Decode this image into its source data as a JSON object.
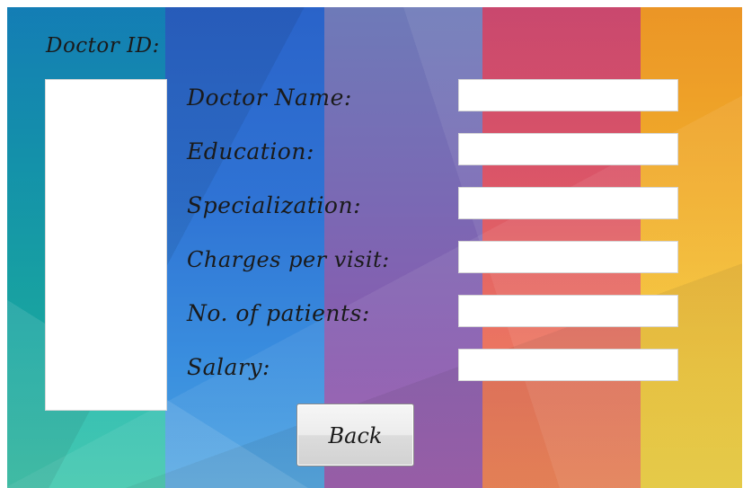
{
  "form": {
    "doctor_id_label": "Doctor ID:",
    "fields": [
      {
        "label": "Doctor Name:",
        "value": ""
      },
      {
        "label": "Education:",
        "value": ""
      },
      {
        "label": "Specialization:",
        "value": ""
      },
      {
        "label": "Charges per visit:",
        "value": ""
      },
      {
        "label": "No. of patients:",
        "value": ""
      },
      {
        "label": "Salary:",
        "value": ""
      }
    ],
    "back_label": "Back"
  }
}
